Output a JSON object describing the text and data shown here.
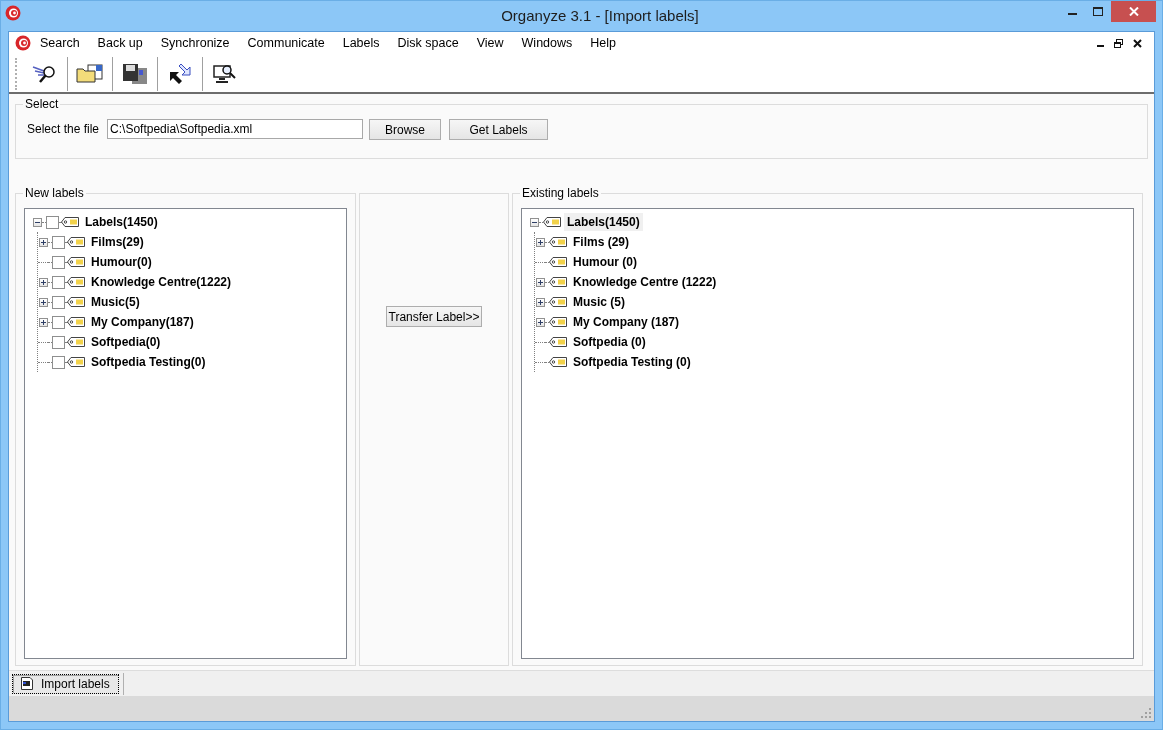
{
  "window": {
    "title": "Organyze 3.1 - [Import labels]"
  },
  "menu": [
    "Search",
    "Back up",
    "Synchronize",
    "Communicate",
    "Labels",
    "Disk space",
    "View",
    "Windows",
    "Help"
  ],
  "select_group": {
    "title": "Select",
    "file_label": "Select the file",
    "file_value": "C:\\Softpedia\\Softpedia.xml",
    "buttons": [
      "Browse",
      "Get Labels"
    ]
  },
  "new_labels": {
    "title": "New labels",
    "tree": {
      "label": "Labels(1450)",
      "expanded": true,
      "checked": false,
      "selected": false,
      "children": [
        {
          "label": "Films(29)",
          "expanded": false,
          "checked": false,
          "selected": false
        },
        {
          "label": "Humour(0)",
          "checked": false,
          "selected": false
        },
        {
          "label": "Knowledge Centre(1222)",
          "expanded": false,
          "checked": false,
          "selected": false
        },
        {
          "label": "Music(5)",
          "expanded": false,
          "checked": false,
          "selected": false
        },
        {
          "label": "My Company(187)",
          "expanded": false,
          "checked": false,
          "selected": false
        },
        {
          "label": "Softpedia(0)",
          "checked": false,
          "selected": false
        },
        {
          "label": "Softpedia Testing(0)",
          "checked": false,
          "selected": false
        }
      ]
    }
  },
  "transfer_button": "Transfer Label>>",
  "existing_labels": {
    "title": "Existing labels",
    "tree": {
      "label": "Labels(1450)",
      "expanded": true,
      "selected": true,
      "children": [
        {
          "label": "Films (29)",
          "expanded": false,
          "selected": false
        },
        {
          "label": "Humour (0)",
          "selected": false
        },
        {
          "label": "Knowledge Centre (1222)",
          "expanded": false,
          "selected": false
        },
        {
          "label": "Music (5)",
          "expanded": false,
          "selected": false
        },
        {
          "label": "My Company (187)",
          "expanded": false,
          "selected": false
        },
        {
          "label": "Softpedia (0)",
          "selected": false
        },
        {
          "label": "Softpedia Testing (0)",
          "selected": false
        }
      ]
    }
  },
  "tabs": [
    {
      "label": "Import labels",
      "selected": true
    }
  ]
}
